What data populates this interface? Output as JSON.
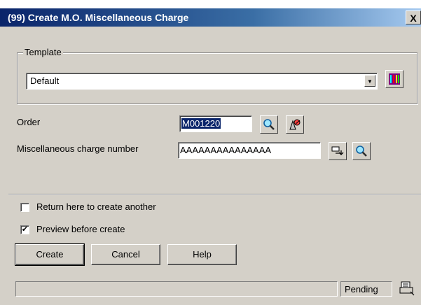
{
  "window": {
    "title": "(99) Create M.O. Miscellaneous Charge",
    "close_glyph": "X"
  },
  "template_group": {
    "legend": "Template",
    "selected_value": "Default",
    "dropdown_icon": "chevron-down-icon",
    "options_icon": "report-grid-icon"
  },
  "order": {
    "label": "Order",
    "value": "M001220",
    "search_icon": "magnifier-icon",
    "browse_icon": "lookup-icon"
  },
  "misc_charge": {
    "label": "Miscellaneous charge number",
    "value": "AAAAAAAAAAAAAAA",
    "generate_icon": "next-number-icon",
    "search_icon": "magnifier-icon"
  },
  "options": {
    "return_here": {
      "label": "Return here to create another",
      "checked": false
    },
    "preview": {
      "label": "Preview before create",
      "checked": true
    }
  },
  "buttons": {
    "create": "Create",
    "cancel": "Cancel",
    "help": "Help"
  },
  "status": {
    "message": "",
    "state": "Pending",
    "icon": "printer-icon"
  },
  "colors": {
    "title_start": "#0a246a",
    "title_end": "#a6caf0",
    "face": "#d4d0c8"
  }
}
